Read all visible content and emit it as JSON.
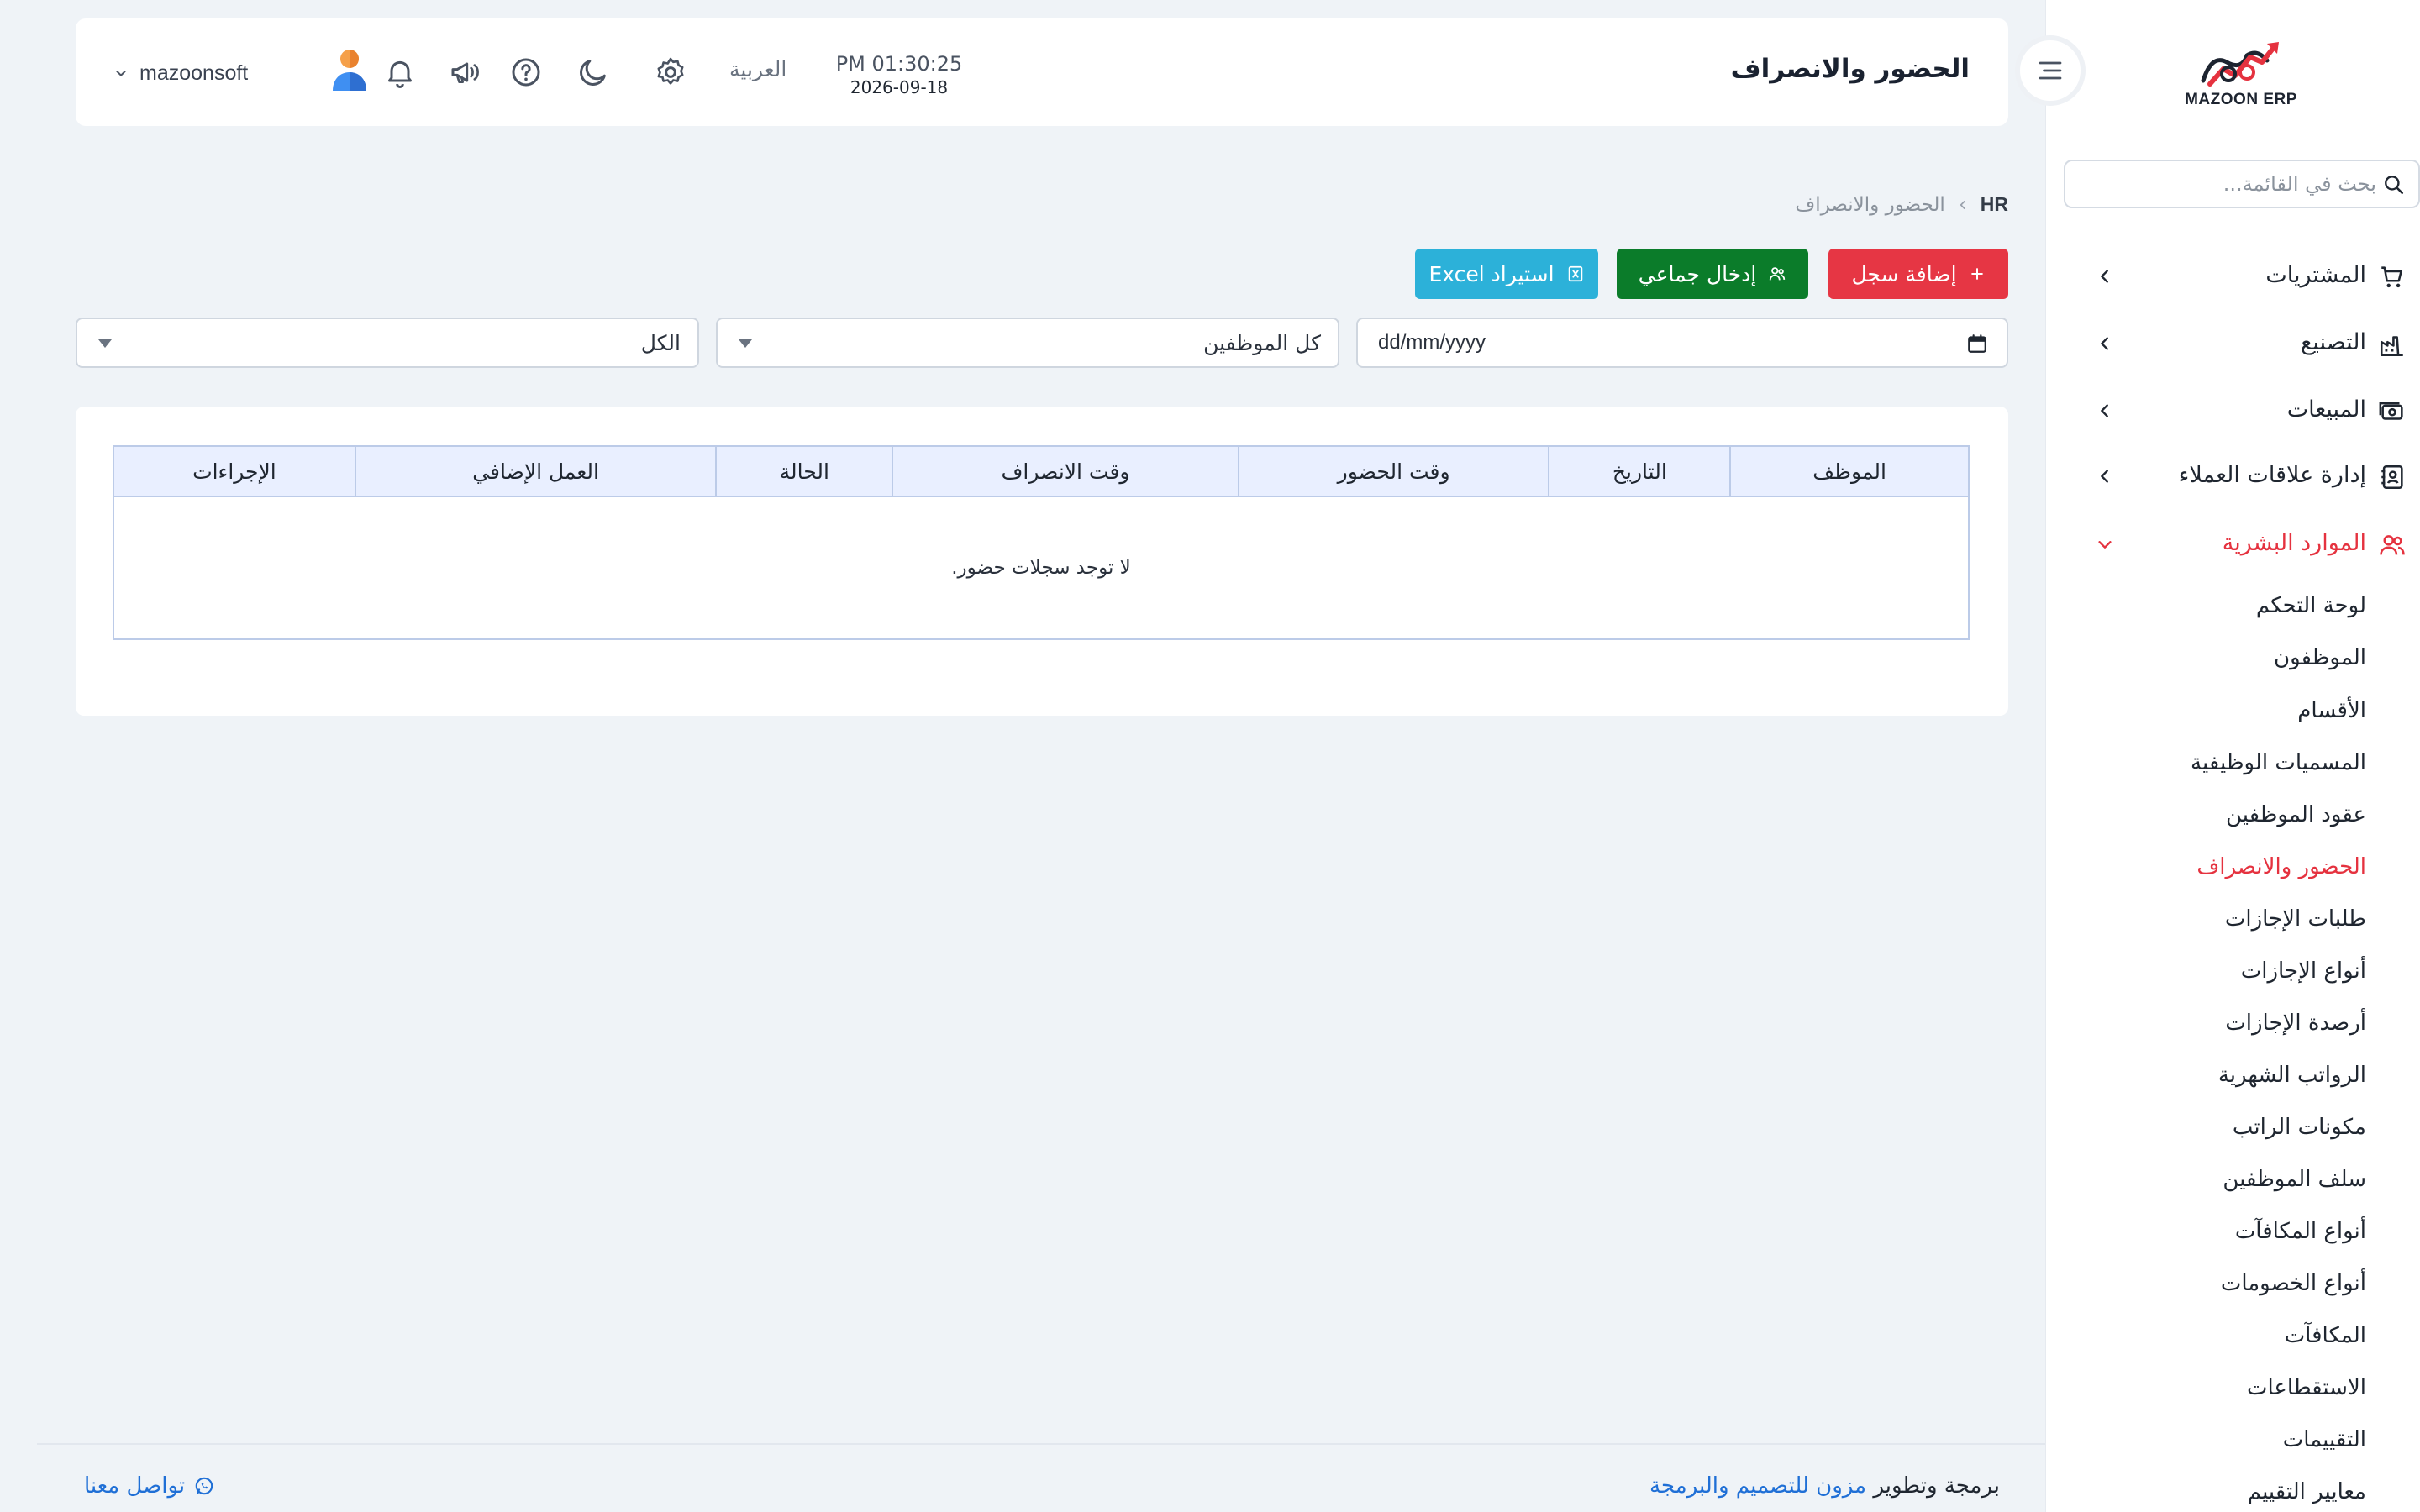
{
  "brand": {
    "logo_text": "MAZOON ERP",
    "accent": "#e5323f"
  },
  "sidebar": {
    "search_placeholder": "بحث في القائمة...",
    "items": [
      {
        "label": "المشتريات",
        "icon": "cart-icon"
      },
      {
        "label": "التصنيع",
        "icon": "factory-icon"
      },
      {
        "label": "المبيعات",
        "icon": "cash-icon"
      },
      {
        "label": "إدارة علاقات العملاء",
        "icon": "contacts-icon"
      },
      {
        "label": "الموارد البشرية",
        "icon": "users-icon",
        "expanded": true
      }
    ],
    "hr_sub": [
      "لوحة التحكم",
      "الموظفون",
      "الأقسام",
      "المسميات الوظيفية",
      "عقود الموظفين",
      "الحضور والانصراف",
      "طلبات الإجازات",
      "أنواع الإجازات",
      "أرصدة الإجازات",
      "الرواتب الشهرية",
      "مكونات الراتب",
      "سلف الموظفين",
      "أنواع المكافآت",
      "أنواع الخصومات",
      "المكافآت",
      "الاستقطاعات",
      "التقييمات",
      "معايير التقييم"
    ],
    "active_sub": "الحضور والانصراف"
  },
  "header": {
    "title": "الحضور والانصراف",
    "time": "PM 01:30:25",
    "date": "2026-09-18",
    "language": "العربية",
    "user": "mazoonsoft"
  },
  "breadcrumb": {
    "root": "HR",
    "current": "الحضور والانصراف"
  },
  "actions": {
    "add": "إضافة سجل",
    "bulk": "إدخال جماعي",
    "excel": "استيراد Excel"
  },
  "filters": {
    "date_placeholder": "dd/mm/yyyy",
    "employee": "كل الموظفين",
    "status": "الكل"
  },
  "table": {
    "columns": [
      "الموظف",
      "التاريخ",
      "وقت الحضور",
      "وقت الانصراف",
      "الحالة",
      "العمل الإضافي",
      "الإجراءات"
    ],
    "empty": "لا توجد سجلات حضور."
  },
  "footer": {
    "credit_prefix": "برمجة وتطوير",
    "credit_link": "مزون للتصميم والبرمجة",
    "contact": "تواصل معنا"
  }
}
